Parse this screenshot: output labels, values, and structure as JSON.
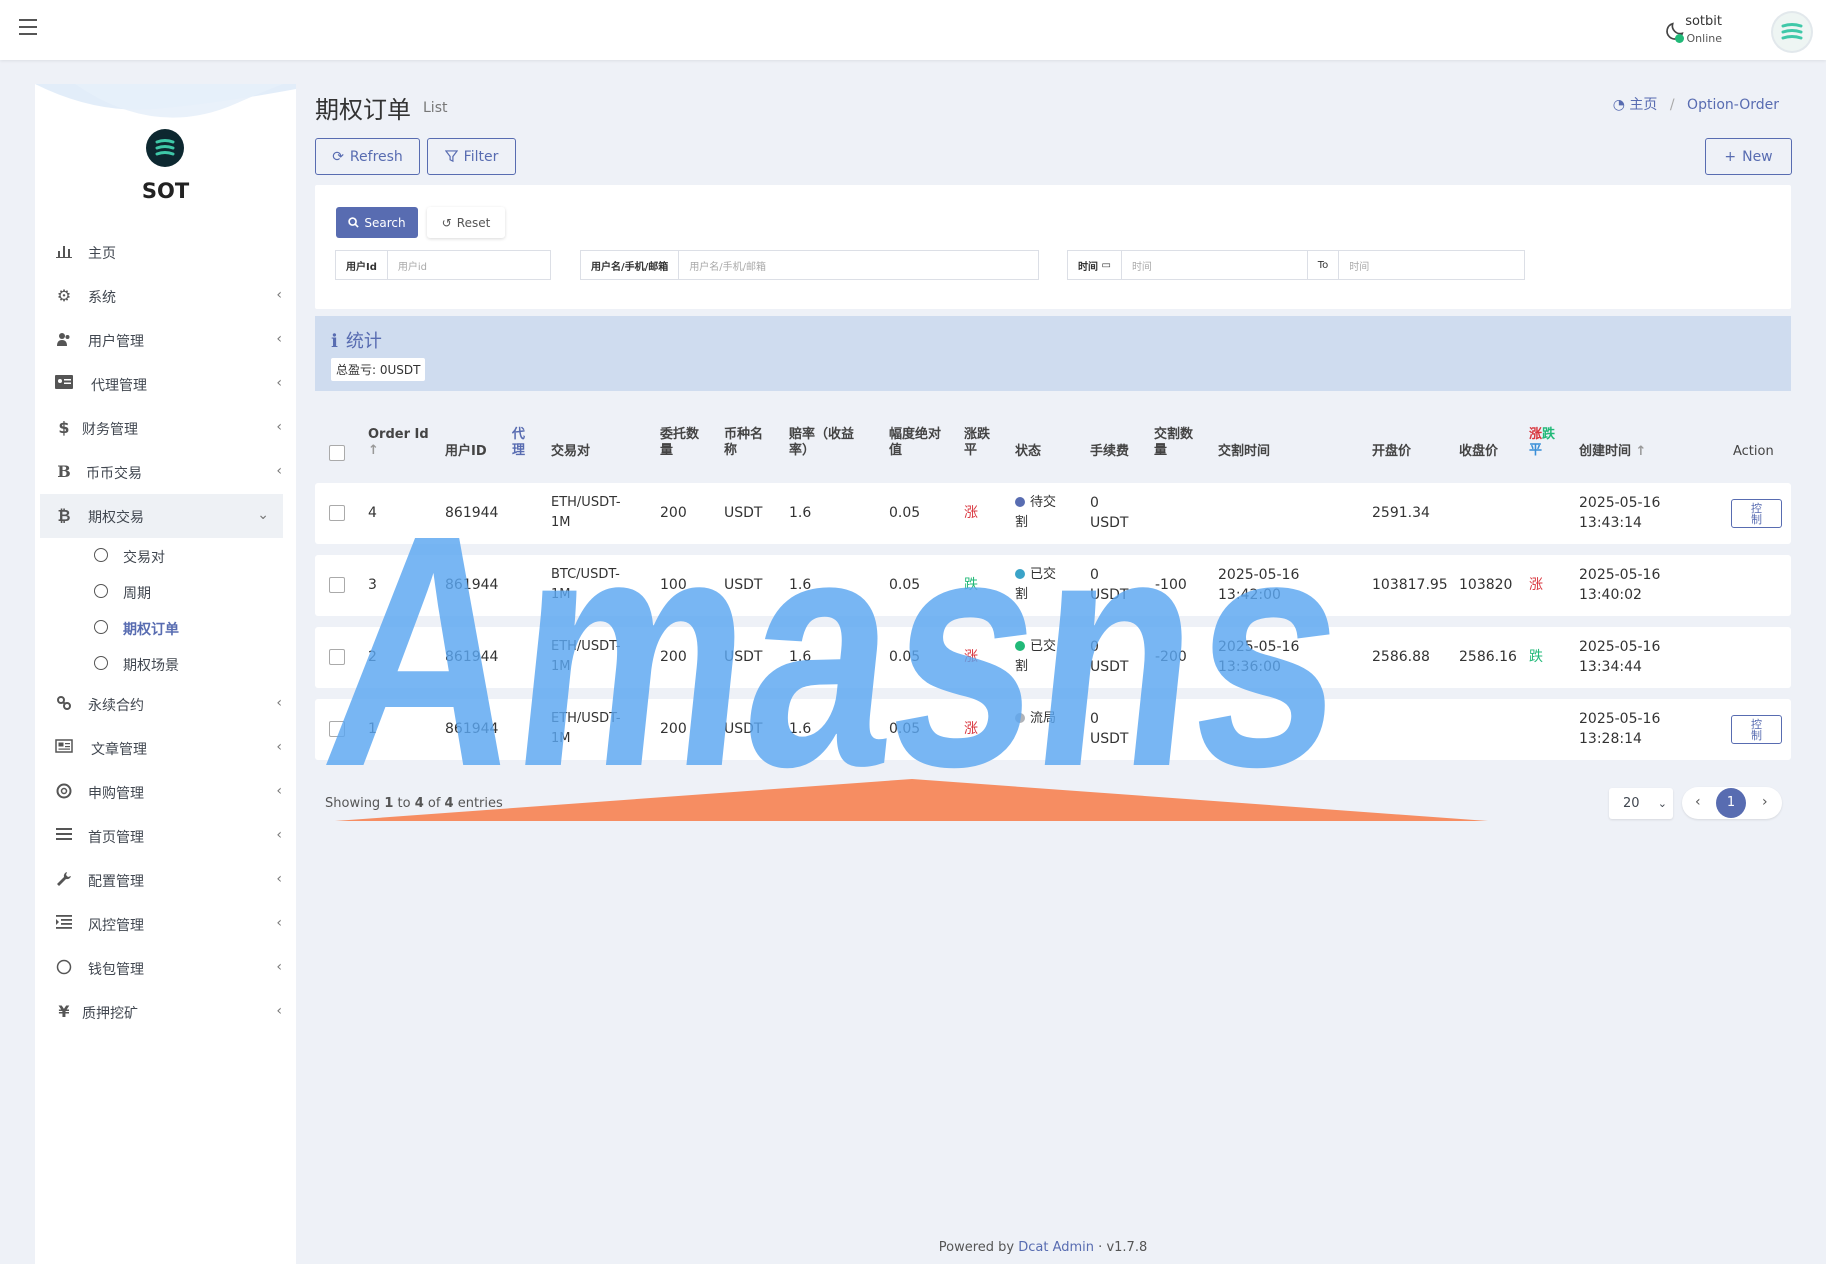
{
  "header": {
    "user_name": "sotbit",
    "user_status": "Online"
  },
  "sidebar": {
    "brand": "SOT",
    "items": [
      {
        "label": "主页",
        "icon": "bar-chart-icon"
      },
      {
        "label": "系统",
        "icon": "gear-icon"
      },
      {
        "label": "用户管理",
        "icon": "users-icon"
      },
      {
        "label": "代理管理",
        "icon": "id-card-icon"
      },
      {
        "label": "财务管理",
        "icon": "dollar-icon"
      },
      {
        "label": "币币交易",
        "icon": "b-icon"
      },
      {
        "label": "期权交易",
        "icon": "bitcoin-icon"
      },
      {
        "label": "永续合约",
        "icon": "link-icon"
      },
      {
        "label": "文章管理",
        "icon": "newspaper-icon"
      },
      {
        "label": "申购管理",
        "icon": "life-ring-icon"
      },
      {
        "label": "首页管理",
        "icon": "list-icon"
      },
      {
        "label": "配置管理",
        "icon": "wrench-icon"
      },
      {
        "label": "风控管理",
        "icon": "indent-icon"
      },
      {
        "label": "钱包管理",
        "icon": "circle-icon"
      },
      {
        "label": "质押挖矿",
        "icon": "yen-icon"
      }
    ],
    "sub_items": [
      {
        "label": "交易对"
      },
      {
        "label": "周期"
      },
      {
        "label": "期权订单"
      },
      {
        "label": "期权场景"
      }
    ]
  },
  "page": {
    "title": "期权订单",
    "subtitle": "List",
    "breadcrumb_home": "主页",
    "breadcrumb_sep": "/",
    "breadcrumb_current": "Option-Order"
  },
  "toolbar": {
    "refresh": "Refresh",
    "filter": "Filter",
    "new": "New"
  },
  "search": {
    "search_btn": "Search",
    "reset_btn": "Reset",
    "user_id_label": "用户Id",
    "user_id_placeholder": "用户id",
    "user_name_label": "用户名/手机/邮箱",
    "user_name_placeholder": "用户名/手机/邮箱",
    "time_label": "时间",
    "time_placeholder": "时间",
    "to_label": "To",
    "time_to_placeholder": "时间"
  },
  "stats": {
    "title": "统计",
    "total_label": "总盈亏: ",
    "total_value": "0USDT"
  },
  "table": {
    "headers": {
      "order_id_1": "Order Id",
      "user_id": "用户ID",
      "agent_1": "代",
      "agent_2": "理",
      "pair": "交易对",
      "qty_1": "委托数",
      "qty_2": "量",
      "coin_1": "币种名",
      "coin_2": "称",
      "rate_1": "赔率（收益",
      "rate_2": "率）",
      "amp_1": "幅度绝对",
      "amp_2": "值",
      "dir_1": "涨跌",
      "dir_2": "平",
      "status": "状态",
      "fee": "手续费",
      "deliv_qty_1": "交割数",
      "deliv_qty_2": "量",
      "deliv_time": "交割时间",
      "open": "开盘价",
      "close": "收盘价",
      "result_up": "涨",
      "result_down": "跌",
      "result_flat": "平",
      "created": "创建时间",
      "action": "Action"
    },
    "rows": [
      {
        "id": "4",
        "user": "861944",
        "pair_1": "ETH/USDT-",
        "pair_2": "1M",
        "qty": "200",
        "coin": "USDT",
        "rate": "1.6",
        "amp": "0.05",
        "dir": "涨",
        "status_1": "待交",
        "status_2": "割",
        "fee_1": "0",
        "fee_2": "USDT",
        "deliv_qty": "",
        "deliv_time_1": "",
        "deliv_time_2": "",
        "open": "2591.34",
        "close": "",
        "result": "",
        "created_1": "2025-05-16",
        "created_2": "13:43:14",
        "action_1": "控",
        "action_2": "制"
      },
      {
        "id": "3",
        "user": "861944",
        "pair_1": "BTC/USDT-",
        "pair_2": "1M",
        "qty": "100",
        "coin": "USDT",
        "rate": "1.6",
        "amp": "0.05",
        "dir": "跌",
        "status_1": "已交",
        "status_2": "割",
        "fee_1": "0",
        "fee_2": "USDT",
        "deliv_qty": "-100",
        "deliv_time_1": "2025-05-16",
        "deliv_time_2": "13:42:00",
        "open": "103817.95",
        "close": "103820",
        "result": "涨",
        "created_1": "2025-05-16",
        "created_2": "13:40:02",
        "action_1": "",
        "action_2": ""
      },
      {
        "id": "2",
        "user": "861944",
        "pair_1": "ETH/USDT-",
        "pair_2": "1M",
        "qty": "200",
        "coin": "USDT",
        "rate": "1.6",
        "amp": "0.05",
        "dir": "涨",
        "status_1": "已交",
        "status_2": "割",
        "fee_1": "0",
        "fee_2": "USDT",
        "deliv_qty": "-200",
        "deliv_time_1": "2025-05-16",
        "deliv_time_2": "13:36:00",
        "open": "2586.88",
        "close": "2586.16",
        "result": "跌",
        "created_1": "2025-05-16",
        "created_2": "13:34:44",
        "action_1": "",
        "action_2": ""
      },
      {
        "id": "1",
        "user": "861944",
        "pair_1": "ETH/USDT-",
        "pair_2": "1M",
        "qty": "200",
        "coin": "USDT",
        "rate": "1.6",
        "amp": "0.05",
        "dir": "涨",
        "status_1": "流局",
        "status_2": "",
        "fee_1": "0",
        "fee_2": "USDT",
        "deliv_qty": "",
        "deliv_time_1": "",
        "deliv_time_2": "",
        "open": "",
        "close": "",
        "result": "",
        "created_1": "2025-05-16",
        "created_2": "13:28:14",
        "action_1": "控",
        "action_2": "制"
      }
    ]
  },
  "pagination": {
    "showing": "Showing ",
    "from": "1",
    "to_word": " to ",
    "to": "4",
    "of_word": " of ",
    "total": "4",
    "entries_word": " entries",
    "page_size": "20",
    "current_page": "1"
  },
  "footer": {
    "powered_by": "Powered by ",
    "link": "Dcat Admin",
    "sep": " · ",
    "version": "v1.7.8"
  },
  "watermark": {
    "text": "Amasns"
  },
  "colors": {
    "primary": "#586cb1",
    "up": "#d9363e",
    "down": "#21b978",
    "status_pending": "#586cb1",
    "status_done_info": "#3aa3c8",
    "status_done_success": "#21b978",
    "status_void": "#b0b3b8"
  }
}
